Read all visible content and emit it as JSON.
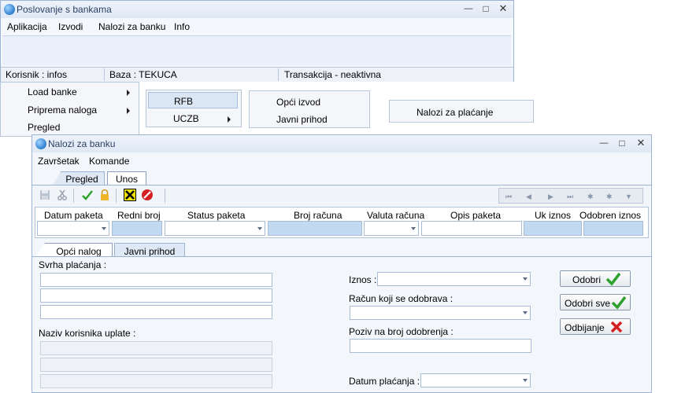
{
  "main_window": {
    "title": "Poslovanje s bankama",
    "menu": [
      "Aplikacija",
      "Izvodi",
      "Nalozi za banku",
      "Info"
    ],
    "status": {
      "user": "Korisnik : infos",
      "db": "Baza : TEKUCA",
      "transaction": "Transakcija - neaktivna"
    }
  },
  "dropdown_menu_1": [
    "Load banke",
    "Priprema naloga",
    "Pregled"
  ],
  "dropdown_menu_2": [
    "RFB",
    "UCZB"
  ],
  "dropdown_menu_3": [
    "Opći izvod",
    "Javni prihod"
  ],
  "dropdown_menu_4": [
    "Nalozi za plaćanje"
  ],
  "child_window": {
    "title": "Nalozi za banku",
    "menu": [
      "Završetak",
      "Komande"
    ],
    "tabs": [
      "Pregled",
      "Unos"
    ],
    "active_tab": "Unos",
    "columns": [
      "Datum paketa",
      "Redni broj",
      "Status paketa",
      "Broj računa",
      "Valuta računa",
      "Opis paketa",
      "Uk iznos",
      "Odobren iznos"
    ],
    "subtabs": [
      "Opći nalog",
      "Javni prihod"
    ],
    "active_subtab": "Opći nalog",
    "form": {
      "svrha_label": "Svrha plaćanja :",
      "naziv_label": "Naziv korisnika uplate :",
      "iznos_label": "Iznos :",
      "racun_label": "Račun koji se odobrava :",
      "poziv_label": "Poziv na broj odobrenja :",
      "datum_label": "Datum plaćanja :"
    },
    "buttons": {
      "odobri": "Odobri",
      "odobri_sve": "Odobri sve",
      "odbijanje": "Odbijanje"
    }
  },
  "colors": {
    "title_text": "#2b3f63",
    "border": "#9db3d3",
    "blue_field": "#c2d9f2",
    "check_green": "#2ea02e",
    "cross_red": "#d42020"
  }
}
